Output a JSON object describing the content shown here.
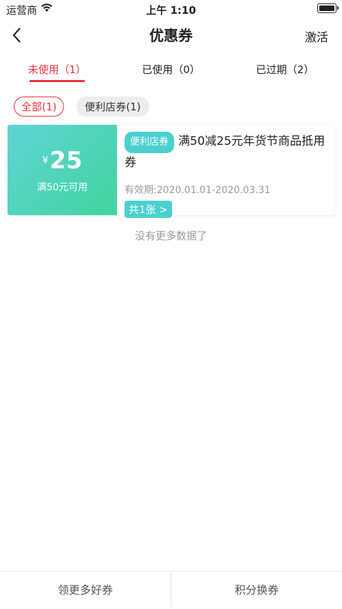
{
  "status": {
    "carrier": "运营商",
    "time": "上午 1:10"
  },
  "nav": {
    "title": "优惠券",
    "activate": "激活"
  },
  "tabs": [
    {
      "label": "未使用（1）"
    },
    {
      "label": "已使用（0）"
    },
    {
      "label": "已过期（2）"
    }
  ],
  "filters": [
    {
      "label": "全部(1)"
    },
    {
      "label": "便利店券(1)"
    }
  ],
  "coupon": {
    "currency": "¥",
    "amount": "25",
    "condition": "满50元可用",
    "tag": "便利店券",
    "name": "满50减25元年货节商品抵用券",
    "validity": "有效期:2020.01.01-2020.03.31",
    "count": "共1张 >"
  },
  "empty_note": "没有更多数据了",
  "bottom": {
    "left": "领更多好券",
    "right": "积分换券"
  },
  "colors": {
    "accent": "#e8313c",
    "coupon_teal": "#4ccfcf"
  }
}
